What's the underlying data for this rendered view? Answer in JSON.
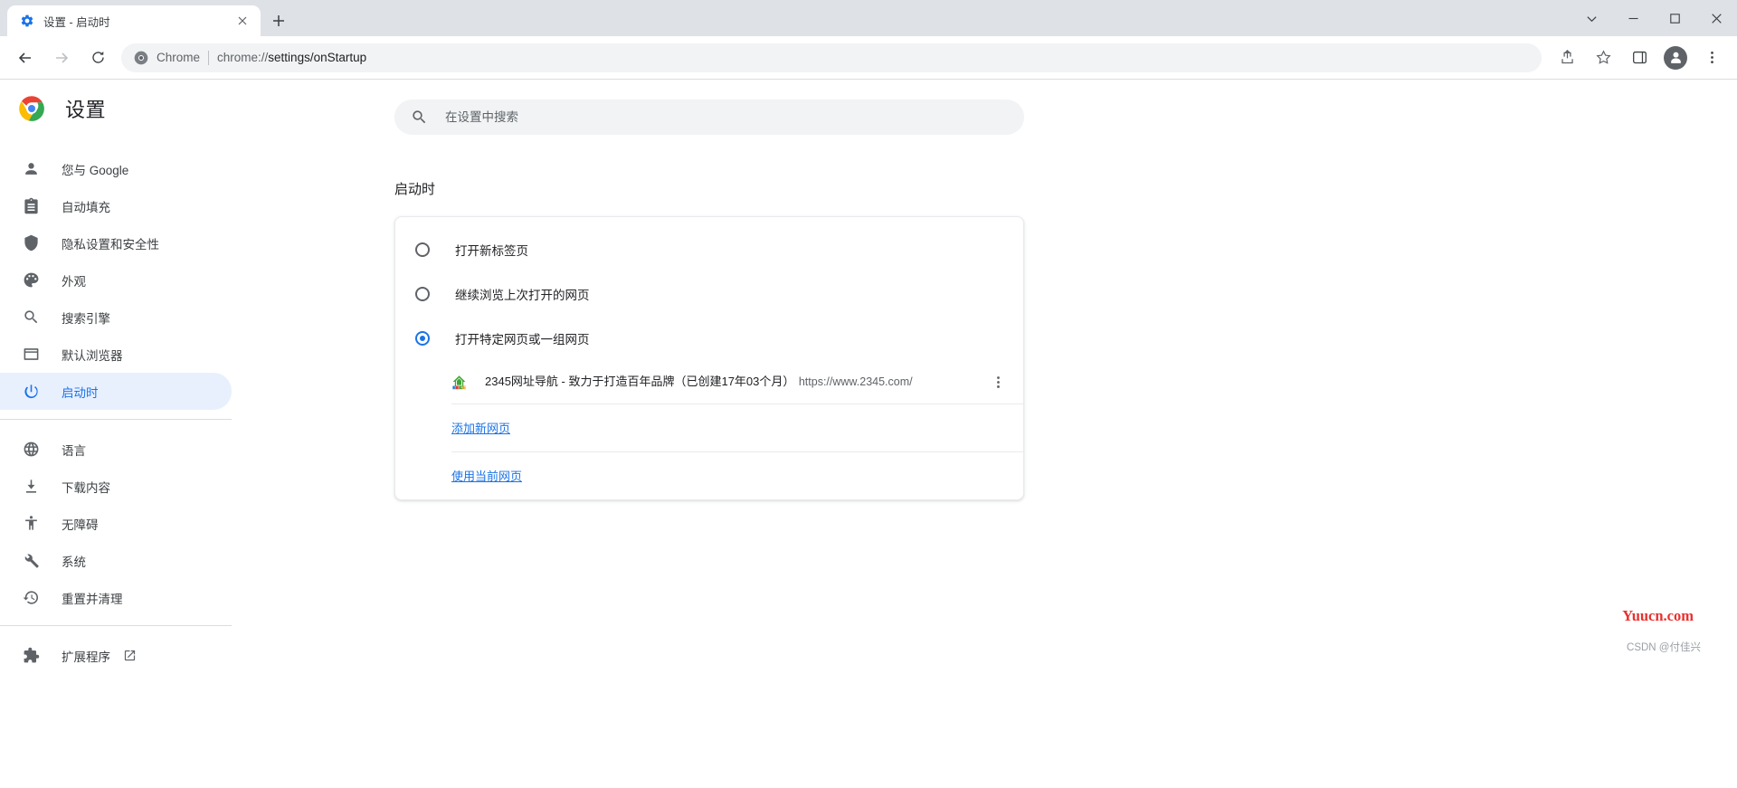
{
  "browser": {
    "tab": {
      "title": "设置 - 启动时",
      "favicon_icon": "blue-gear-icon",
      "close_icon": "close-icon"
    },
    "new_tab_icon": "plus-icon",
    "window_controls": {
      "menu_caret_icon": "chevron-down-icon",
      "minimize_icon": "minimize-icon",
      "maximize_icon": "maximize-icon",
      "close_icon": "window-close-icon"
    },
    "toolbar": {
      "back_icon": "arrow-left-icon",
      "forward_icon": "arrow-right-icon",
      "reload_icon": "reload-icon",
      "omnibox": {
        "chrome_icon": "chrome-logo-icon",
        "chip_label": "Chrome",
        "url_prefix": "chrome://",
        "url_bold": "settings/onStartup"
      },
      "share_icon": "share-icon",
      "bookmark_icon": "star-icon",
      "sidepanel_icon": "side-panel-icon",
      "profile_icon": "person-avatar-icon",
      "menu_icon": "kebab-menu-icon"
    }
  },
  "settings": {
    "brand": {
      "logo_icon": "chrome-logo-icon",
      "title": "设置"
    },
    "sidebar": {
      "items": [
        {
          "label": "您与 Google",
          "icon": "person-icon",
          "selected": false
        },
        {
          "label": "自动填充",
          "icon": "clipboard-icon",
          "selected": false
        },
        {
          "label": "隐私设置和安全性",
          "icon": "shield-icon",
          "selected": false
        },
        {
          "label": "外观",
          "icon": "palette-icon",
          "selected": false
        },
        {
          "label": "搜索引擎",
          "icon": "search-icon",
          "selected": false
        },
        {
          "label": "默认浏览器",
          "icon": "browser-window-icon",
          "selected": false
        },
        {
          "label": "启动时",
          "icon": "power-icon",
          "selected": true
        }
      ],
      "items_group2": [
        {
          "label": "语言",
          "icon": "globe-icon",
          "selected": false
        },
        {
          "label": "下载内容",
          "icon": "download-icon",
          "selected": false
        },
        {
          "label": "无障碍",
          "icon": "accessibility-icon",
          "selected": false
        },
        {
          "label": "系统",
          "icon": "wrench-icon",
          "selected": false
        },
        {
          "label": "重置并清理",
          "icon": "history-restore-icon",
          "selected": false
        }
      ],
      "items_group3": [
        {
          "label": "扩展程序",
          "icon": "puzzle-piece-icon",
          "external_icon": "external-link-icon",
          "selected": false
        }
      ]
    },
    "search": {
      "placeholder": "在设置中搜索",
      "value": "",
      "icon": "search-icon"
    },
    "main": {
      "section_title": "启动时",
      "options": [
        {
          "label": "打开新标签页",
          "checked": false
        },
        {
          "label": "继续浏览上次打开的网页",
          "checked": false
        },
        {
          "label": "打开特定网页或一组网页",
          "checked": true
        }
      ],
      "startup_sites": [
        {
          "title": "2345网址导航 - 致力于打造百年品牌（已创建17年03个月）",
          "url": "https://www.2345.com/",
          "favicon_icon": "2345-house-favicon",
          "more_icon": "kebab-menu-icon"
        }
      ],
      "add_page_link": "添加新网页",
      "use_current_pages_link": "使用当前网页"
    }
  },
  "watermarks": {
    "red": "Yuucn.com",
    "gray": "CSDN @付佳兴"
  },
  "colors": {
    "accent": "#1a73e8",
    "selected_bg": "#e8f0fe",
    "text_primary": "#202124",
    "text_secondary": "#5f6368",
    "chrome_tabstrip": "#dee1e6",
    "field_bg": "#f1f3f4",
    "watermark_red": "#e8312f"
  }
}
